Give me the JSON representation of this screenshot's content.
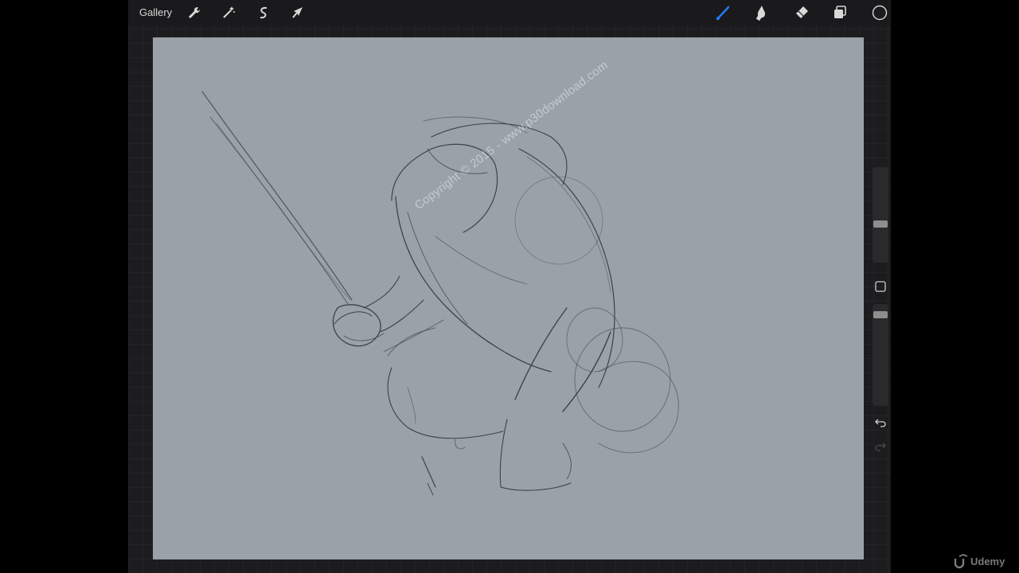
{
  "toolbar": {
    "gallery_label": "Gallery",
    "left_icons": [
      "wrench-icon",
      "magic-wand-icon",
      "selection-icon",
      "transform-arrow-icon"
    ],
    "right_icons": [
      "brush-icon",
      "smudge-icon",
      "eraser-icon",
      "layers-icon",
      "color-picker-icon"
    ],
    "active_tool": "brush",
    "accent_color": "#1e7cf5"
  },
  "canvas": {
    "background_color": "#9aa2a8",
    "content": "pencil sketch of a crouching figure holding a sword"
  },
  "sidebar": {
    "brush_size": 0.55,
    "opacity": 0.9,
    "buttons": [
      "modify-button",
      "undo-icon",
      "redo-icon"
    ]
  },
  "watermark": {
    "text": "Copyright © 2015 - www.p30download.com"
  },
  "brand": {
    "name": "Udemy"
  }
}
